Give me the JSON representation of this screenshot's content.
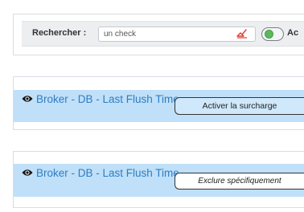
{
  "search": {
    "label": "Rechercher :",
    "value": "un check",
    "toggle_label": "Ac",
    "toggle_on": true
  },
  "services": [
    {
      "title": "Broker - DB - Last Flush Time",
      "button_label": "Activer la surcharge"
    },
    {
      "title": "Broker - DB - Last Flush Time",
      "button_label": "Exclure spécifiquement"
    }
  ],
  "colors": {
    "row_background": "#bfe0f8",
    "link_blue": "#2f7dc3",
    "toggle_green": "#5cb85c",
    "clear_icon_red": "#e03c31"
  }
}
